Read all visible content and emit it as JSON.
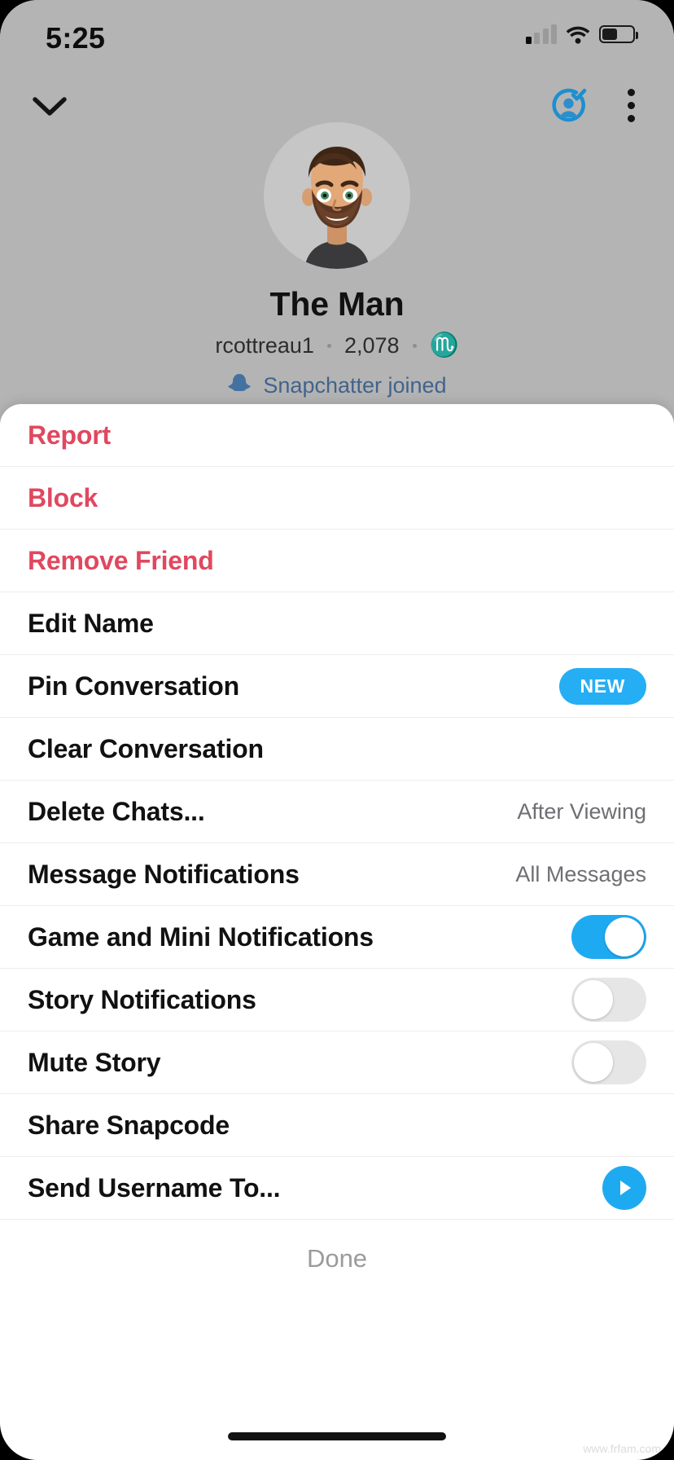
{
  "status_bar": {
    "time": "5:25",
    "signal_icon": "cellular-bars-icon",
    "wifi_icon": "wifi-icon",
    "battery_icon": "battery-icon"
  },
  "nav": {
    "back_icon": "chevron-down-icon",
    "friend_added_icon": "person-check-icon",
    "more_icon": "kebab-menu-icon"
  },
  "profile": {
    "avatar_icon": "bitmoji-avatar",
    "display_name": "The Man",
    "username": "rcottreau1",
    "snap_score": "2,078",
    "zodiac": "♏",
    "sub_row_icon": "snapchat-ghost-icon",
    "sub_row_text": "Snapchatter joined"
  },
  "sheet": {
    "rows": [
      {
        "label": "Report",
        "style": "danger",
        "control": "none"
      },
      {
        "label": "Block",
        "style": "danger",
        "control": "none"
      },
      {
        "label": "Remove Friend",
        "style": "danger",
        "control": "none"
      },
      {
        "label": "Edit Name",
        "style": "normal",
        "control": "none"
      },
      {
        "label": "Pin Conversation",
        "style": "normal",
        "control": "badge",
        "badge": "NEW"
      },
      {
        "label": "Clear Conversation",
        "style": "normal",
        "control": "none"
      },
      {
        "label": "Delete Chats...",
        "style": "normal",
        "control": "detail",
        "detail": "After Viewing"
      },
      {
        "label": "Message Notifications",
        "style": "normal",
        "control": "detail",
        "detail": "All Messages"
      },
      {
        "label": "Game and Mini Notifications",
        "style": "normal",
        "control": "toggle",
        "toggle_state": "on"
      },
      {
        "label": "Story Notifications",
        "style": "normal",
        "control": "toggle",
        "toggle_state": "off"
      },
      {
        "label": "Mute Story",
        "style": "normal",
        "control": "toggle",
        "toggle_state": "off"
      },
      {
        "label": "Share Snapcode",
        "style": "normal",
        "control": "none"
      },
      {
        "label": "Send Username To...",
        "style": "normal",
        "control": "send",
        "send_icon": "send-arrow-icon"
      }
    ],
    "done_label": "Done"
  },
  "colors": {
    "danger": "#e0485f",
    "accent_blue": "#1eaaf1",
    "badge_blue": "#25aef3",
    "sheet_bg": "#ffffff",
    "backdrop": "#b4b4b4",
    "detail_gray": "#6e6e73",
    "done_gray": "#9b9b9b"
  },
  "watermark": "www.frfam.com"
}
